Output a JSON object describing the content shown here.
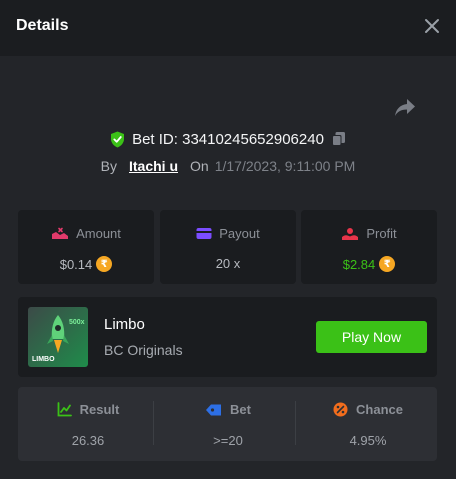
{
  "header": {
    "title": "Details"
  },
  "bet": {
    "id_text": "Bet ID: 33410245652906240",
    "by_label": "By",
    "user": "Itachi u",
    "on_label": "On",
    "date": "1/17/2023, 9:11:00 PM"
  },
  "stats": {
    "amount": {
      "label": "Amount",
      "value": "$0.14"
    },
    "payout": {
      "label": "Payout",
      "value": "20 x"
    },
    "profit": {
      "label": "Profit",
      "value": "$2.84"
    }
  },
  "game": {
    "name": "Limbo",
    "provider": "BC Originals",
    "play_label": "Play Now",
    "thumb_badge": "500x",
    "thumb_title": "LIMBO"
  },
  "result": {
    "result": {
      "label": "Result",
      "value": "26.36"
    },
    "bet": {
      "label": "Bet",
      "value": ">=20"
    },
    "chance": {
      "label": "Chance",
      "value": "4.95%"
    }
  },
  "colors": {
    "accent_green": "#3bc117",
    "coin_orange": "#f6a723",
    "amount_icon": "#e23a6b",
    "payout_icon": "#7b4dff",
    "profit_icon": "#e8344a"
  },
  "icons": {
    "close": "close-icon",
    "share": "share-icon",
    "verified": "shield-check-icon",
    "copy": "copy-icon",
    "coin": "rupee-coin-icon"
  }
}
